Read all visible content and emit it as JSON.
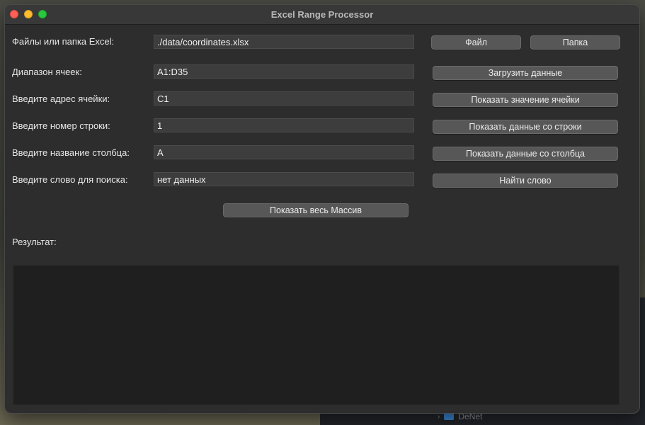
{
  "window": {
    "title": "Excel Range Processor"
  },
  "form": {
    "path": {
      "label": "Файлы или папка Excel:",
      "value": "./data/coordinates.xlsx"
    },
    "range": {
      "label": "Диапазон ячеек:",
      "value": "A1:D35"
    },
    "cell_address": {
      "label": "Введите адрес ячейки:",
      "value": "C1"
    },
    "row_number": {
      "label": "Введите номер строки:",
      "value": "1"
    },
    "column_name": {
      "label": "Введите название столбца:",
      "value": "A"
    },
    "search_word": {
      "label": "Введите слово для поиска:",
      "value": "нет данных"
    }
  },
  "buttons": {
    "file": "Файл",
    "folder": "Папка",
    "load_data": "Загрузить данные",
    "show_cell_value": "Показать значение ячейки",
    "show_row_data": "Показать данные со строки",
    "show_column_data": "Показать данные со столбца",
    "find_word": "Найти слово",
    "show_all_array": "Показать весь Массив"
  },
  "result": {
    "label": "Результат:",
    "text": ""
  },
  "background": {
    "sidebar_item": "DeNet"
  }
}
